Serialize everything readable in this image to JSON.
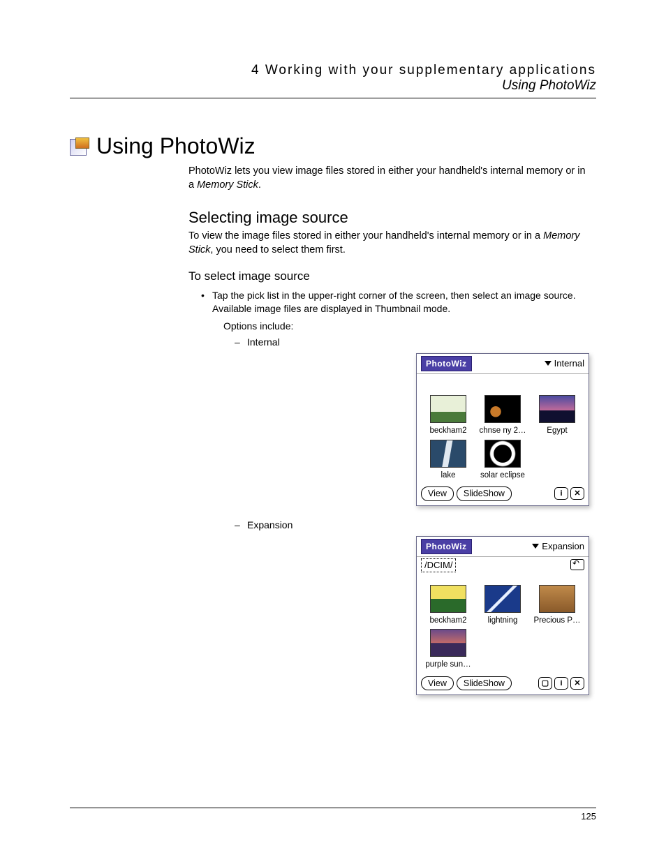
{
  "header": {
    "chapter_line": "4 Working with your supplementary applications",
    "section_line": "Using PhotoWiz"
  },
  "title": "Using PhotoWiz",
  "intro_part1": "PhotoWiz lets you view image files stored in either your handheld's internal memory or in a ",
  "intro_em": "Memory Stick",
  "intro_part2": ".",
  "sub": {
    "title": "Selecting image source",
    "text_part1": "To view the image files stored in either your handheld's internal memory or in a ",
    "text_em": "Memory Stick",
    "text_part2": ", you need to select them first."
  },
  "task": {
    "title": "To select image source",
    "bullet": "Tap the pick list in the upper-right corner of the screen, then select an image source. Available image files are displayed in Thumbnail mode.",
    "options_label": "Options include:",
    "opt1": "Internal",
    "opt2": "Expansion"
  },
  "app": {
    "name": "PhotoWiz",
    "view_btn": "View",
    "slideshow_btn": "SlideShow",
    "info_icon": "i",
    "close_icon": "✕",
    "sd_icon": "▢"
  },
  "shot1": {
    "picklist": "Internal",
    "thumbs": [
      {
        "label": "beckham2",
        "art": "art-sport"
      },
      {
        "label": "chnse ny 2…",
        "art": "art-horses"
      },
      {
        "label": "Egypt",
        "art": "art-egypt"
      },
      {
        "label": "lake",
        "art": "art-lake"
      },
      {
        "label": "solar eclipse",
        "art": "art-eclipse"
      }
    ]
  },
  "shot2": {
    "picklist": "Expansion",
    "path": "/DCIM/",
    "thumbs": [
      {
        "label": "beckham2",
        "art": "art-stadium"
      },
      {
        "label": "lightning",
        "art": "art-lightning"
      },
      {
        "label": "Precious P…",
        "art": "art-precious"
      },
      {
        "label": "purple sun…",
        "art": "art-purple"
      }
    ]
  },
  "page_number": "125"
}
